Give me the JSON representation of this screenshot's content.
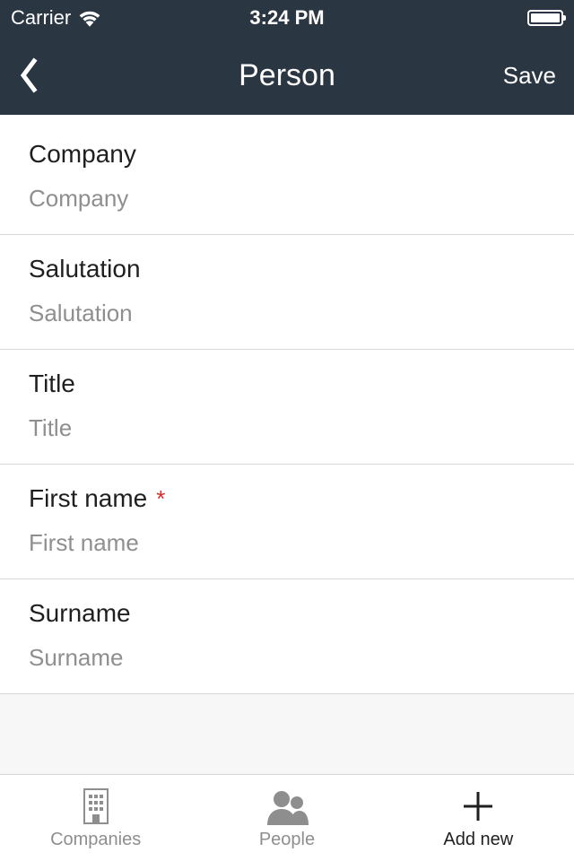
{
  "status": {
    "carrier": "Carrier",
    "time": "3:24 PM"
  },
  "nav": {
    "title": "Person",
    "save_label": "Save"
  },
  "form": {
    "fields": [
      {
        "label": "Company",
        "placeholder": "Company",
        "value": "",
        "required": false
      },
      {
        "label": "Salutation",
        "placeholder": "Salutation",
        "value": "",
        "required": false
      },
      {
        "label": "Title",
        "placeholder": "Title",
        "value": "",
        "required": false
      },
      {
        "label": "First name",
        "placeholder": "First name",
        "value": "",
        "required": true
      },
      {
        "label": "Surname",
        "placeholder": "Surname",
        "value": "",
        "required": false
      }
    ]
  },
  "tabs": {
    "items": [
      {
        "label": "Companies",
        "active": false
      },
      {
        "label": "People",
        "active": false
      },
      {
        "label": "Add new",
        "active": true
      }
    ]
  }
}
